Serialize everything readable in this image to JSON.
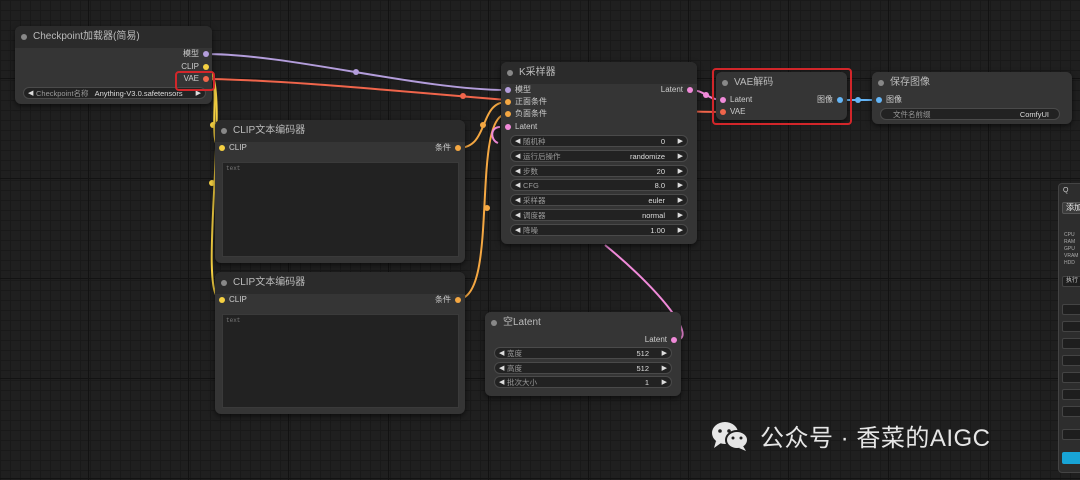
{
  "colors": {
    "model": "#b39ddb",
    "clip": "#f5d042",
    "vae": "#f0654b",
    "conditioning": "#f4a742",
    "latent": "#f08ad9",
    "image": "#64b5f6",
    "highlight": "#d2262a"
  },
  "checkpoint_node": {
    "title": "Checkpoint加载器(简易)",
    "outputs": [
      "模型",
      "CLIP",
      "VAE"
    ],
    "widget_label": "Checkpoint名称",
    "widget_value": "Anything-V3.0.safetensors"
  },
  "clip_node_1": {
    "title": "CLIP文本编码器",
    "input": "CLIP",
    "output": "条件",
    "text": "text"
  },
  "clip_node_2": {
    "title": "CLIP文本编码器",
    "input": "CLIP",
    "output": "条件",
    "text": "text"
  },
  "ksampler_node": {
    "title": "K采样器",
    "inputs": [
      "模型",
      "正面条件",
      "负面条件",
      "Latent"
    ],
    "output": "Latent",
    "widgets": [
      {
        "label": "随机种",
        "value": "0"
      },
      {
        "label": "运行后操作",
        "value": "randomize"
      },
      {
        "label": "步数",
        "value": "20"
      },
      {
        "label": "CFG",
        "value": "8.0"
      },
      {
        "label": "采样器",
        "value": "euler"
      },
      {
        "label": "调度器",
        "value": "normal"
      },
      {
        "label": "降噪",
        "value": "1.00"
      }
    ]
  },
  "vae_node": {
    "title": "VAE解码",
    "inputs": [
      "Latent",
      "VAE"
    ],
    "output": "图像"
  },
  "save_node": {
    "title": "保存图像",
    "input": "图像",
    "widget_label": "文件名前缀",
    "widget_value": "ComfyUI"
  },
  "empty_latent_node": {
    "title": "空Latent",
    "output": "Latent",
    "widgets": [
      {
        "label": "宽度",
        "value": "512"
      },
      {
        "label": "高度",
        "value": "512"
      },
      {
        "label": "批次大小",
        "value": "1"
      }
    ]
  },
  "side_panel": {
    "title": "Q",
    "button": "添加",
    "stats": [
      "CPU",
      "RAM",
      "GPU",
      "VRAM",
      "HDD"
    ],
    "action": "执行"
  },
  "watermark": {
    "text": "公众号 · 香菜的AIGC"
  }
}
